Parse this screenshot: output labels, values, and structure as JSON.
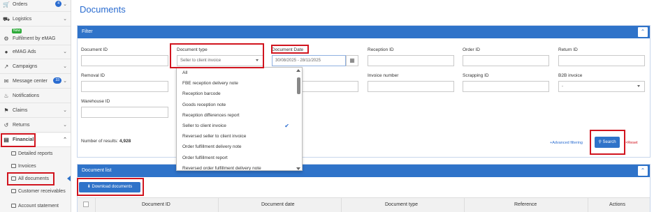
{
  "sidebar": {
    "items": [
      {
        "label": "Orders",
        "badge": "4"
      },
      {
        "label": "Logistics"
      },
      {
        "label": "Fulfilment by eMAG",
        "tag": "New"
      },
      {
        "label": "eMAG Ads"
      },
      {
        "label": "Campaigns"
      },
      {
        "label": "Message center",
        "badge": "33"
      },
      {
        "label": "Notifications"
      },
      {
        "label": "Claims"
      },
      {
        "label": "Returns"
      },
      {
        "label": "Financial"
      }
    ],
    "financial_sub": [
      {
        "label": "Detailed reports"
      },
      {
        "label": "Invoices"
      },
      {
        "label": "All documents"
      },
      {
        "label": "Customer receivables"
      },
      {
        "label": "Account statement"
      }
    ]
  },
  "page": {
    "title": "Documents"
  },
  "filter": {
    "title": "Filter",
    "fields": {
      "document_id": {
        "label": "Document ID",
        "value": ""
      },
      "document_type": {
        "label": "Document type",
        "value": "Seller to client invoice"
      },
      "document_date": {
        "label": "Document Date",
        "value": "30/08/2025 - 28/11/2025"
      },
      "reception_id": {
        "label": "Reception ID",
        "value": ""
      },
      "order_id": {
        "label": "Order ID",
        "value": ""
      },
      "return_id": {
        "label": "Return ID",
        "value": ""
      },
      "removal_id": {
        "label": "Removal ID",
        "value": ""
      },
      "invoice_number": {
        "label": "Invoice number",
        "value": ""
      },
      "scrapping_id": {
        "label": "Scrapping ID",
        "value": ""
      },
      "b2b_invoice": {
        "label": "B2B invoice",
        "value": "-"
      },
      "warehouse_id": {
        "label": "Warehouse ID",
        "value": ""
      }
    },
    "results_label": "Number of results:",
    "results_count": "4,928",
    "advanced_filtering": "Advanced filtering",
    "search": "Search",
    "reset": "Reset"
  },
  "dropdown": {
    "options": [
      "All",
      "FBE reception delivery note",
      "Reception barcode",
      "Goods reception note",
      "Reception differences report",
      "Seller to client invoice",
      "Reversed seller to client invoice",
      "Order fulfillment delivery note",
      "Order fulfillment report",
      "Reversed order fulfillment delivery note"
    ],
    "selected_index": 5
  },
  "document_list": {
    "title": "Document list",
    "download_button": "Download documents",
    "columns": [
      "Document ID",
      "Document date",
      "Document type",
      "Reference",
      "Actions"
    ]
  },
  "colors": {
    "accent": "#2f73c9",
    "highlight": "#d1141e"
  }
}
